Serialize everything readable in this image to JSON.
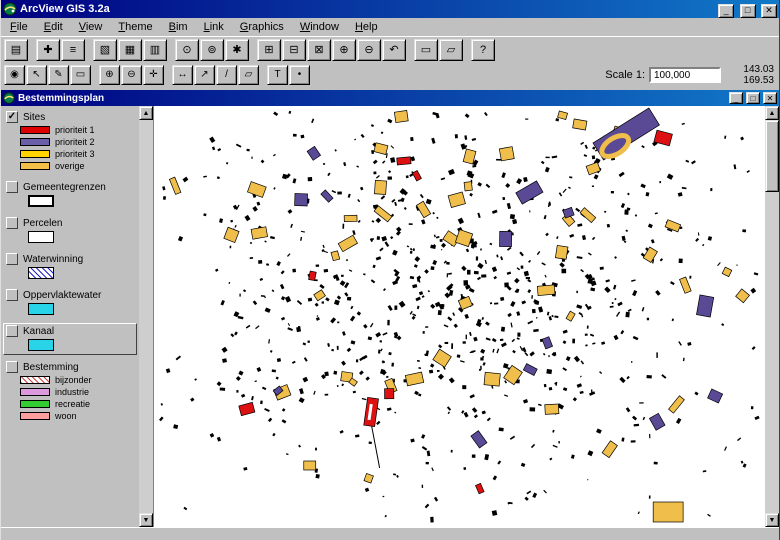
{
  "window": {
    "title": "ArcView GIS 3.2a",
    "controls": {
      "minimize": "_",
      "maximize": "□",
      "close": "✕"
    }
  },
  "menu": {
    "items": [
      "File",
      "Edit",
      "View",
      "Theme",
      "Bim",
      "Link",
      "Graphics",
      "Window",
      "Help"
    ]
  },
  "toolbar1": {
    "buttons": [
      {
        "name": "save-project-button",
        "glyph": "▤"
      },
      {
        "name": "add-theme-button",
        "glyph": "✚",
        "gap": true
      },
      {
        "name": "theme-properties-button",
        "glyph": "≡"
      },
      {
        "name": "edit-legend-button",
        "glyph": "▧",
        "gap": true
      },
      {
        "name": "open-theme-table-button",
        "glyph": "▦"
      },
      {
        "name": "create-chart-button",
        "glyph": "▥"
      },
      {
        "name": "find-button",
        "glyph": "⊙",
        "gap": true
      },
      {
        "name": "locate-address-button",
        "glyph": "⊚"
      },
      {
        "name": "query-builder-button",
        "glyph": "✱"
      },
      {
        "name": "zoom-full-extent-button",
        "glyph": "⊞",
        "gap": true
      },
      {
        "name": "zoom-active-theme-button",
        "glyph": "⊟"
      },
      {
        "name": "zoom-selected-button",
        "glyph": "⊠"
      },
      {
        "name": "zoom-in-button",
        "glyph": "⊕"
      },
      {
        "name": "zoom-out-button",
        "glyph": "⊖"
      },
      {
        "name": "zoom-previous-button",
        "glyph": "↶"
      },
      {
        "name": "select-features-button",
        "glyph": "▭",
        "gap": true
      },
      {
        "name": "clear-selection-button",
        "glyph": "▱"
      },
      {
        "name": "help-button",
        "glyph": "?",
        "gap": true
      }
    ]
  },
  "toolbar2": {
    "buttons": [
      {
        "name": "identify-tool",
        "glyph": "◉"
      },
      {
        "name": "pointer-tool",
        "glyph": "↖"
      },
      {
        "name": "vertex-edit-tool",
        "glyph": "✎"
      },
      {
        "name": "select-feature-tool",
        "glyph": "▭"
      },
      {
        "name": "zoom-in-tool",
        "glyph": "⊕",
        "gap": true
      },
      {
        "name": "zoom-out-tool",
        "glyph": "⊖"
      },
      {
        "name": "pan-tool",
        "glyph": "✛"
      },
      {
        "name": "measure-tool",
        "glyph": "↔",
        "gap": true
      },
      {
        "name": "hotlink-tool",
        "glyph": "↗"
      },
      {
        "name": "draw-line-tool",
        "glyph": "/"
      },
      {
        "name": "draw-polygon-tool",
        "glyph": "▱"
      },
      {
        "name": "text-tool",
        "glyph": "T",
        "gap": true
      },
      {
        "name": "draw-point-tool",
        "glyph": "•"
      }
    ],
    "scale_label": "Scale 1:",
    "scale_value": "100,000",
    "coord_x": "143.03",
    "coord_y": "169.53"
  },
  "document": {
    "title": "Bestemmingsplan",
    "controls": {
      "minimize": "_",
      "maximize": "□",
      "close": "✕"
    }
  },
  "legend": {
    "check_glyph": "✓",
    "themes": [
      {
        "name": "Sites",
        "checked": true,
        "selected": false,
        "items": [
          {
            "label": "prioriteit 1",
            "type": "fill",
            "color": "#dd0000"
          },
          {
            "label": "prioriteit 2",
            "type": "fill",
            "color": "#6a5fa8"
          },
          {
            "label": "prioriteit 3",
            "type": "fill",
            "color": "#ffd400"
          },
          {
            "label": "overige",
            "type": "fill",
            "color": "#f2bf49"
          }
        ]
      },
      {
        "name": "Gemeentegrenzen",
        "checked": false,
        "selected": false,
        "items": [
          {
            "label": "",
            "type": "outline-thick",
            "color": "#ffffff"
          }
        ]
      },
      {
        "name": "Percelen",
        "checked": false,
        "selected": false,
        "items": [
          {
            "label": "",
            "type": "outline-thin",
            "color": "#ffffff"
          }
        ]
      },
      {
        "name": "Waterwinning",
        "checked": false,
        "selected": false,
        "items": [
          {
            "label": "",
            "type": "hatch",
            "color": "#2222cc"
          }
        ]
      },
      {
        "name": "Oppervlaktewater",
        "checked": false,
        "selected": false,
        "items": [
          {
            "label": "",
            "type": "fill",
            "color": "#2ad4e8"
          }
        ]
      },
      {
        "name": "Kanaal",
        "checked": false,
        "selected": true,
        "items": [
          {
            "label": "",
            "type": "fill",
            "color": "#2ad4e8"
          }
        ]
      },
      {
        "name": "Bestemming",
        "checked": false,
        "selected": false,
        "items": [
          {
            "label": "bijzonder",
            "type": "hatch",
            "color": "#cc4444"
          },
          {
            "label": "industrie",
            "type": "fill",
            "color": "#dd99dd"
          },
          {
            "label": "recreatie",
            "type": "fill",
            "color": "#33cc33"
          },
          {
            "label": "woon",
            "type": "fill",
            "color": "#ff9e9e"
          }
        ]
      }
    ]
  },
  "map": {
    "background": "#ffffff",
    "parcel_color": "#000000",
    "feature_colors": {
      "yellow": "#f0be4a",
      "purple": "#5a4a96",
      "red": "#dd1111"
    }
  },
  "scrollbar": {
    "up": "▲",
    "down": "▼"
  }
}
